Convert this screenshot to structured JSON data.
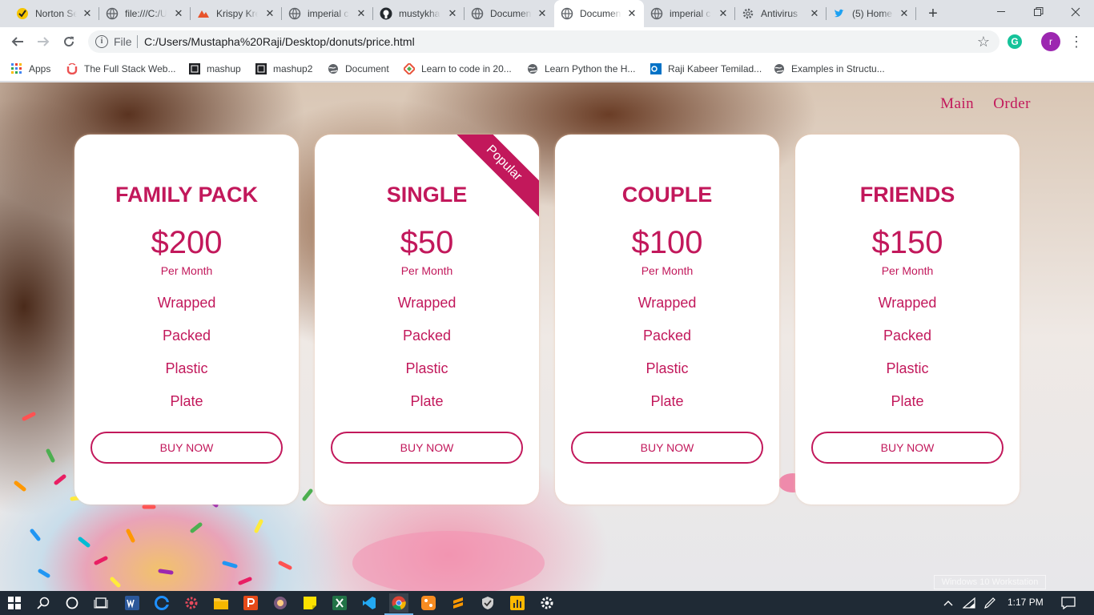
{
  "browser": {
    "tabs": [
      {
        "title": "Norton Security",
        "icon": "norton-icon"
      },
      {
        "title": "file:///C:/Users",
        "icon": "globe-icon"
      },
      {
        "title": "Krispy Kreme",
        "icon": "krispy-kreme-icon"
      },
      {
        "title": "imperial college",
        "icon": "globe-icon"
      },
      {
        "title": "mustykhan",
        "icon": "github-icon"
      },
      {
        "title": "Document",
        "icon": "globe-icon"
      },
      {
        "title": "Document",
        "icon": "globe-icon",
        "active": true
      },
      {
        "title": "imperial college",
        "icon": "globe-icon"
      },
      {
        "title": "Antivirus",
        "icon": "gear-icon"
      },
      {
        "title": "(5) Home",
        "icon": "twitter-icon"
      }
    ],
    "omnibox": {
      "scheme_label": "File",
      "url": "C:/Users/Mustapha%20Raji/Desktop/donuts/price.html"
    },
    "profile_initial": "r",
    "bookmarks": [
      {
        "label": "Apps",
        "icon": "apps-grid-icon"
      },
      {
        "label": "The Full Stack Web...",
        "icon": "udemy-icon"
      },
      {
        "label": "mashup",
        "icon": "mashup-icon"
      },
      {
        "label": "mashup2",
        "icon": "mashup-icon"
      },
      {
        "label": "Document",
        "icon": "globe-icon"
      },
      {
        "label": "Learn to code in 20...",
        "icon": "code-icon"
      },
      {
        "label": "Learn Python the H...",
        "icon": "globe-icon"
      },
      {
        "label": "Raji Kabeer Temilad...",
        "icon": "outlook-icon"
      },
      {
        "label": "Examples in Structu...",
        "icon": "globe-icon"
      }
    ]
  },
  "site": {
    "nav": [
      {
        "label": "Main"
      },
      {
        "label": "Order"
      }
    ],
    "plans": [
      {
        "name": "FAMILY PACK",
        "price": "$200",
        "period": "Per Month",
        "features": [
          "Wrapped",
          "Packed",
          "Plastic",
          "Plate"
        ],
        "cta": "BUY NOW"
      },
      {
        "name": "SINGLE",
        "price": "$50",
        "period": "Per Month",
        "features": [
          "Wrapped",
          "Packed",
          "Plastic",
          "Plate"
        ],
        "cta": "BUY NOW",
        "ribbon": "Popular"
      },
      {
        "name": "COUPLE",
        "price": "$100",
        "period": "Per Month",
        "features": [
          "Wrapped",
          "Packed",
          "Plastic",
          "Plate"
        ],
        "cta": "BUY NOW"
      },
      {
        "name": "FRIENDS",
        "price": "$150",
        "period": "Per Month",
        "features": [
          "Wrapped",
          "Packed",
          "Plastic",
          "Plate"
        ],
        "cta": "BUY NOW"
      }
    ],
    "accent_color": "#c2185b"
  },
  "overlay": {
    "watermark": "Windows 10 Workstation"
  },
  "taskbar": {
    "time": "1:17 PM"
  }
}
